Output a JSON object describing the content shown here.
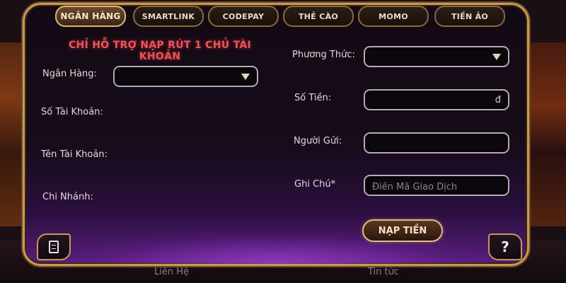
{
  "tabs": [
    {
      "label": "NGÂN HÀNG",
      "active": true
    },
    {
      "label": "SMARTLINK",
      "active": false
    },
    {
      "label": "CODEPAY",
      "active": false
    },
    {
      "label": "THẺ CÀO",
      "active": false
    },
    {
      "label": "MOMO",
      "active": false
    },
    {
      "label": "TIỀN ẢO",
      "active": false
    }
  ],
  "notice": "CHỈ HỖ TRỢ NẠP RÚT 1 CHỦ TÀI KHOẢN",
  "left_form": {
    "bank_label": "Ngân Hàng:",
    "account_number_label": "Số Tài Khoản:",
    "account_name_label": "Tên Tài Khoản:",
    "branch_label": "Chi Nhánh:"
  },
  "right_form": {
    "method_label": "Phương Thức:",
    "amount_label": "Số Tiền:",
    "amount_currency": "đ",
    "sender_label": "Người Gửi:",
    "note_label": "Ghi Chú*",
    "note_placeholder": "Điền Mã Giao Dịch"
  },
  "submit_label": "NẠP TIỀN",
  "help_label": "?",
  "background": {
    "bottom_left_label": "Liên Hệ",
    "bottom_right_label": "Tin tức"
  },
  "colors": {
    "accent_gold": "#c89a5a",
    "notice_red": "#e9555a",
    "panel_glow_purple": "#5a1d7a"
  },
  "icons": {
    "dropdown": "chevron-down-icon",
    "history": "document-icon",
    "help": "question-icon"
  }
}
